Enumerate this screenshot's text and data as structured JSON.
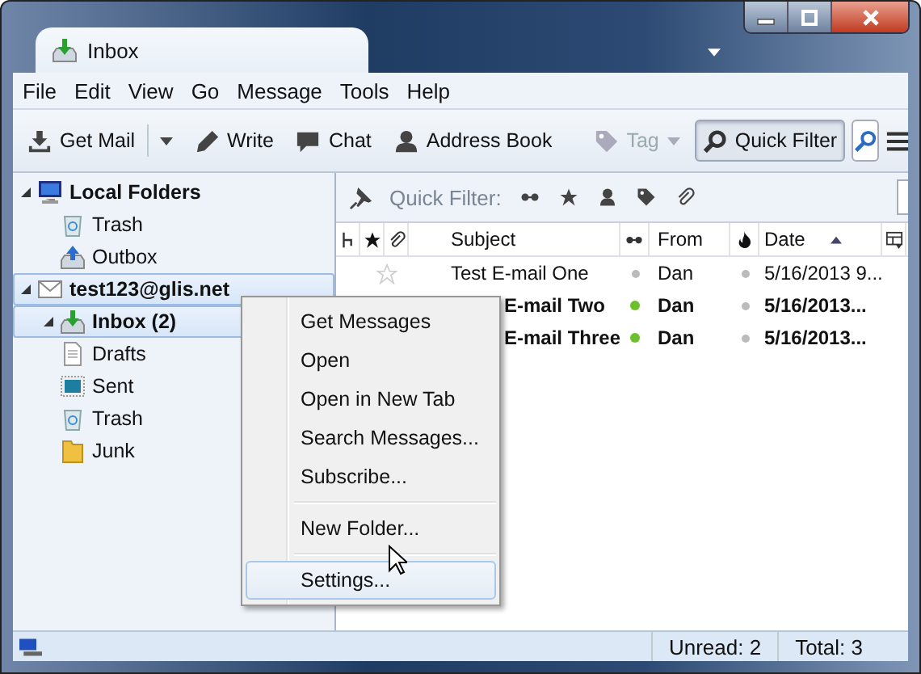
{
  "window": {
    "tab_title": "Inbox"
  },
  "menu_bar": [
    "File",
    "Edit",
    "View",
    "Go",
    "Message",
    "Tools",
    "Help"
  ],
  "toolbar": [
    {
      "kind": "split",
      "label": "Get Mail",
      "disabled": false,
      "pressed": false
    },
    {
      "kind": "button",
      "label": "Write",
      "disabled": false,
      "pressed": false
    },
    {
      "kind": "button",
      "label": "Chat",
      "disabled": false,
      "pressed": false
    },
    {
      "kind": "button",
      "label": "Address Book",
      "disabled": false,
      "pressed": false
    },
    {
      "kind": "dropdown",
      "label": "Tag",
      "disabled": true,
      "pressed": false
    },
    {
      "kind": "button",
      "label": "Quick Filter",
      "disabled": false,
      "pressed": true
    }
  ],
  "folders": [
    {
      "name": "Local Folders",
      "kind": "server",
      "bold": true,
      "selected": false,
      "expanded": true,
      "children": [
        {
          "name": "Trash",
          "kind": "trash",
          "bold": false,
          "selected": false
        },
        {
          "name": "Outbox",
          "kind": "outbox",
          "bold": false,
          "selected": false
        }
      ]
    },
    {
      "name": "test123@glis.net",
      "kind": "account",
      "bold": true,
      "selected": true,
      "expanded": true,
      "children": [
        {
          "name": "Inbox (2)",
          "kind": "inbox",
          "bold": true,
          "selected": true,
          "expanded": true
        },
        {
          "name": "Drafts",
          "kind": "drafts",
          "bold": false,
          "selected": false
        },
        {
          "name": "Sent",
          "kind": "sent",
          "bold": false,
          "selected": false
        },
        {
          "name": "Trash",
          "kind": "trash",
          "bold": false,
          "selected": false
        },
        {
          "name": "Junk",
          "kind": "junk",
          "bold": false,
          "selected": false
        }
      ]
    }
  ],
  "quick_filter": {
    "label": "Quick Filter:"
  },
  "table": {
    "columns": [
      "Subject",
      "From",
      "Date"
    ],
    "rows": [
      {
        "subject": "Test E-mail One",
        "from": "Dan",
        "date": "5/16/2013 9...",
        "unread": false,
        "covered": false
      },
      {
        "subject": "E-mail Two",
        "from": "Dan",
        "date": "5/16/2013...",
        "unread": true,
        "covered": true
      },
      {
        "subject": "E-mail Three",
        "from": "Dan",
        "date": "5/16/2013...",
        "unread": true,
        "covered": true
      }
    ]
  },
  "context_menu": [
    {
      "kind": "item",
      "label": "Get Messages",
      "selected": false
    },
    {
      "kind": "item",
      "label": "Open",
      "selected": false
    },
    {
      "kind": "item",
      "label": "Open in New Tab",
      "selected": false
    },
    {
      "kind": "item",
      "label": "Search Messages...",
      "selected": false
    },
    {
      "kind": "item",
      "label": "Subscribe...",
      "selected": false
    },
    {
      "kind": "separator"
    },
    {
      "kind": "item",
      "label": "New Folder...",
      "selected": false
    },
    {
      "kind": "separator"
    },
    {
      "kind": "item",
      "label": "Settings...",
      "selected": true
    }
  ],
  "status_bar": {
    "unread": "Unread: 2",
    "total": "Total: 3"
  }
}
